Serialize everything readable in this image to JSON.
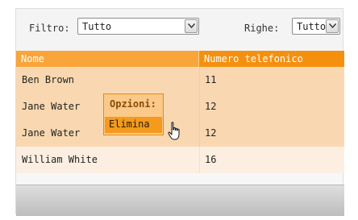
{
  "toolbar": {
    "filter_label": "Filtro:",
    "filter_value": "Tutto",
    "rows_label": "Righe:",
    "rows_value": "Tutto"
  },
  "table": {
    "columns": [
      "Nome",
      "Numero telefonico"
    ],
    "rows": [
      {
        "name": "Ben Brown",
        "phone": "11"
      },
      {
        "name": "Jane Water",
        "phone": "12"
      },
      {
        "name": "Jane Water",
        "phone": "12"
      },
      {
        "name": "William White",
        "phone": "16"
      }
    ]
  },
  "context_menu": {
    "title": "Opzioni:",
    "items": [
      {
        "label": "Elimina"
      }
    ]
  },
  "colors": {
    "header_accent": "#f5900f",
    "row_highlight": "#f9d8b1",
    "menu_item": "#f39a1f"
  },
  "icons": {
    "dropdown": "chevron-down-icon",
    "cursor": "hand-pointer-icon"
  }
}
